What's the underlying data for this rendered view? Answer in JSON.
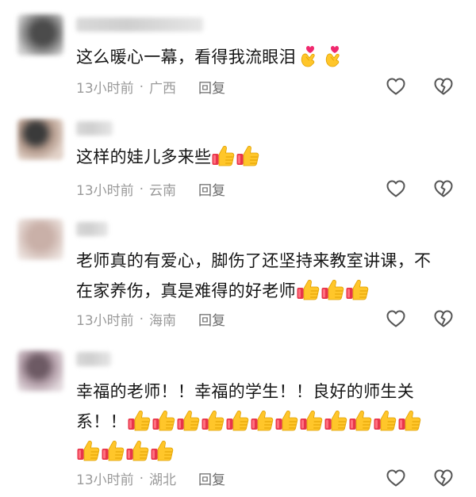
{
  "comments": [
    {
      "text": "这么暖心一幕，看得我流眼泪",
      "emojis": [
        "finger-heart",
        "finger-heart"
      ],
      "time": "13小时前",
      "location": "广西",
      "reply": "回复"
    },
    {
      "text": "这样的娃儿多来些",
      "emojis": [
        "thumbs-up",
        "thumbs-up"
      ],
      "time": "13小时前",
      "location": "云南",
      "reply": "回复"
    },
    {
      "text_line1": "老师真的有爱心，脚伤了还坚持来教室讲课，不",
      "text_line2": "在家养伤，真是难得的好老师",
      "emojis": [
        "thumbs-up",
        "thumbs-up",
        "thumbs-up"
      ],
      "time": "13小时前",
      "location": "海南",
      "reply": "回复"
    },
    {
      "text_line1": "幸福的老师！！幸福的学生！！良好的师生关",
      "text_line2": "系！！",
      "emojis_line2_count": 12,
      "emojis_line3_count": 4,
      "time": "13小时前",
      "location": "湖北",
      "reply": "回复"
    }
  ],
  "icons": {
    "like": "heart-outline-icon",
    "dislike": "broken-heart-icon",
    "emoji_thumb": "thumbs-up-icon",
    "emoji_heart": "finger-heart-icon"
  },
  "colors": {
    "meta_text": "#9a9a9a",
    "reply_text": "#6b6b6b",
    "body_text": "#161616",
    "icon_gray": "#5a5a5a"
  }
}
